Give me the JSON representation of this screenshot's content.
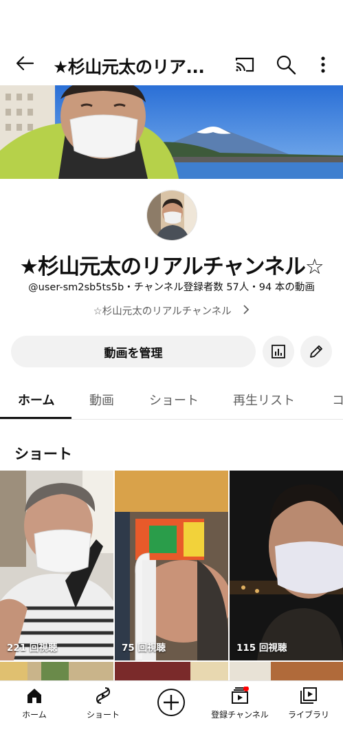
{
  "header": {
    "title": "★杉山元太のリア...",
    "icons": [
      "back-arrow-icon",
      "cast-icon",
      "search-icon",
      "more-vert-icon"
    ]
  },
  "channel": {
    "name": "★杉山元太のリアルチャンネル☆",
    "handle": "@user-sm2sb5ts5b",
    "subscribers": "チャンネル登録者数 57人",
    "videos": "94 本の動画",
    "meta_line": "@user-sm2sb5ts5b・チャンネル登録者数 57人・94 本の動画",
    "description": "☆杉山元太のリアルチャンネル"
  },
  "actions": {
    "manage_label": "動画を管理"
  },
  "tabs": [
    {
      "label": "ホーム",
      "active": true
    },
    {
      "label": "動画",
      "active": false
    },
    {
      "label": "ショート",
      "active": false
    },
    {
      "label": "再生リスト",
      "active": false
    },
    {
      "label": "コ",
      "active": false
    }
  ],
  "shorts_section": {
    "title": "ショート",
    "items": [
      {
        "views": "221 回視聴"
      },
      {
        "views": "75 回視聴"
      },
      {
        "views": "115 回視聴"
      }
    ]
  },
  "bottom_nav": [
    {
      "label": "ホーム",
      "icon": "home-icon",
      "active": true
    },
    {
      "label": "ショート",
      "icon": "shorts-icon",
      "active": false
    },
    {
      "label": "",
      "icon": "create-icon",
      "active": false
    },
    {
      "label": "登録チャンネル",
      "icon": "subscriptions-icon",
      "active": false,
      "badge": true
    },
    {
      "label": "ライブラリ",
      "icon": "library-icon",
      "active": false
    }
  ],
  "colors": {
    "text": "#0f0f0f",
    "secondary_text": "#606060",
    "button_bg": "#f2f2f2",
    "notification_dot": "#ff0000"
  }
}
